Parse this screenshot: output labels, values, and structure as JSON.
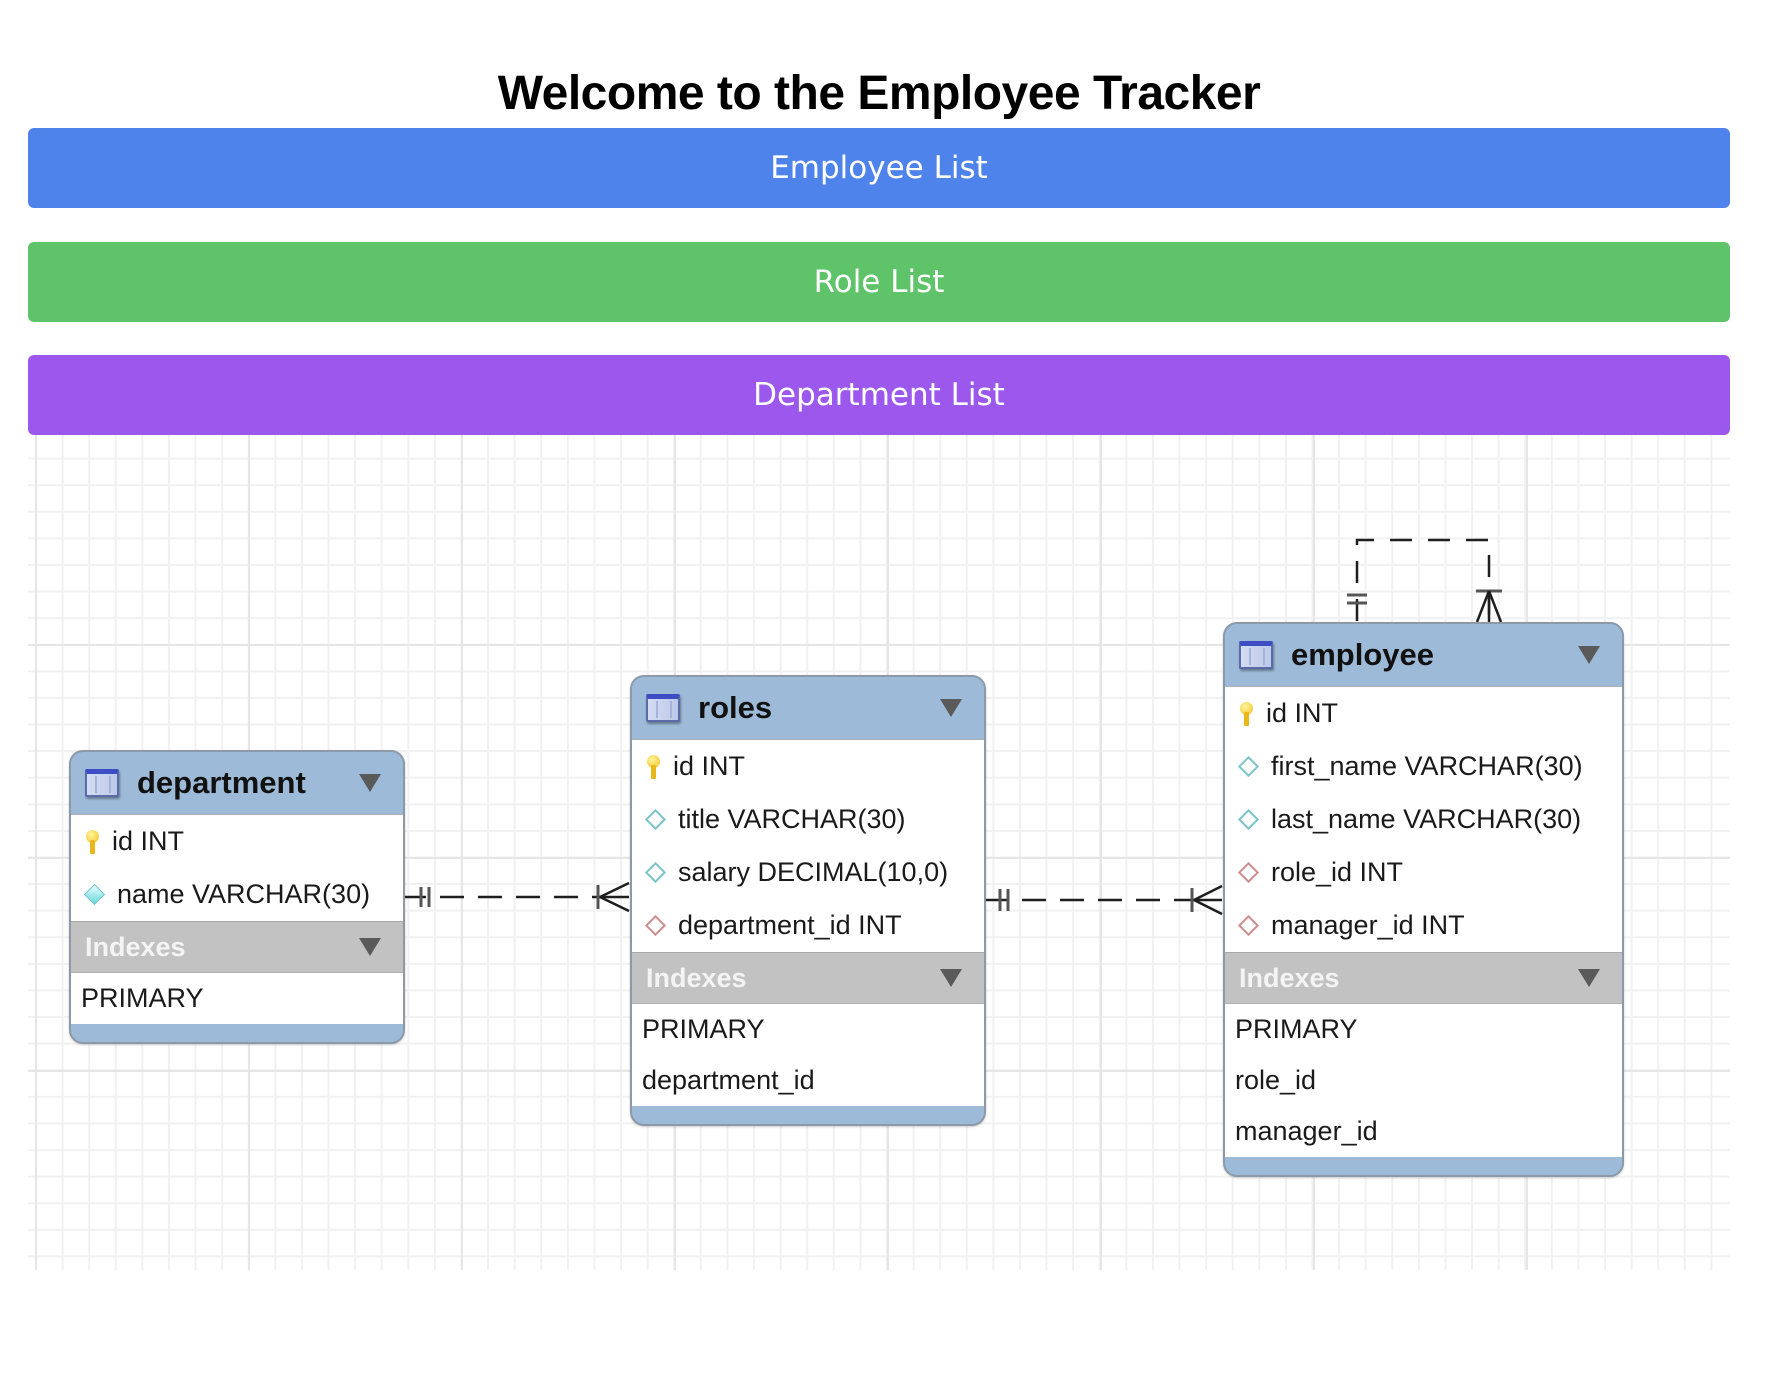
{
  "page": {
    "title": "Welcome to the Employee Tracker"
  },
  "nav": {
    "buttons": [
      {
        "label": "Employee List",
        "color": "#4f83ec"
      },
      {
        "label": "Role List",
        "color": "#5fc36a"
      },
      {
        "label": "Department List",
        "color": "#9c58ed"
      }
    ]
  },
  "diagram": {
    "tables": {
      "department": {
        "name": "department",
        "columns": [
          {
            "text": "id INT",
            "icon": "primary-key-icon"
          },
          {
            "text": "name VARCHAR(30)",
            "icon": "not-null-column-icon"
          }
        ],
        "indexes_label": "Indexes",
        "indexes": [
          "PRIMARY"
        ]
      },
      "roles": {
        "name": "roles",
        "columns": [
          {
            "text": "id INT",
            "icon": "primary-key-icon"
          },
          {
            "text": "title VARCHAR(30)",
            "icon": "column-icon"
          },
          {
            "text": "salary DECIMAL(10,0)",
            "icon": "column-icon"
          },
          {
            "text": "department_id INT",
            "icon": "foreign-key-icon"
          }
        ],
        "indexes_label": "Indexes",
        "indexes": [
          "PRIMARY",
          "department_id"
        ]
      },
      "employee": {
        "name": "employee",
        "columns": [
          {
            "text": "id INT",
            "icon": "primary-key-icon"
          },
          {
            "text": "first_name VARCHAR(30)",
            "icon": "column-icon"
          },
          {
            "text": "last_name VARCHAR(30)",
            "icon": "column-icon"
          },
          {
            "text": "role_id INT",
            "icon": "foreign-key-icon"
          },
          {
            "text": "manager_id INT",
            "icon": "foreign-key-icon"
          }
        ],
        "indexes_label": "Indexes",
        "indexes": [
          "PRIMARY",
          "role_id",
          "manager_id"
        ]
      }
    },
    "relationships": [
      {
        "from": "department",
        "to": "roles",
        "type": "one-to-many"
      },
      {
        "from": "roles",
        "to": "employee",
        "type": "one-to-many"
      },
      {
        "from": "employee",
        "to": "employee",
        "type": "one-to-many (self, manager)"
      }
    ],
    "colors": {
      "table_header": "#9dbbd8",
      "indexes_header": "#c2c2c2"
    }
  }
}
